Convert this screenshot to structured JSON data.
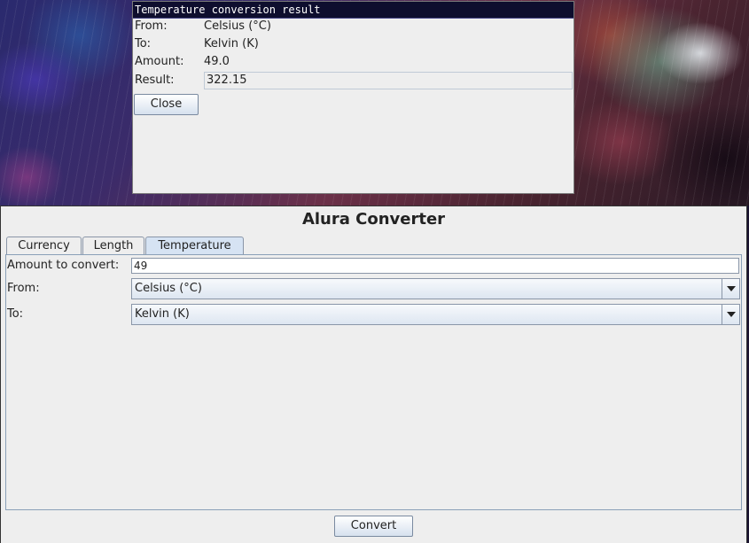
{
  "dialog": {
    "title": "Temperature conversion result",
    "from_label": "From:",
    "from_value": "Celsius (°C)",
    "to_label": "To:",
    "to_value": "Kelvin (K)",
    "amount_label": "Amount:",
    "amount_value": "49.0",
    "result_label": "Result:",
    "result_value": "322.15",
    "close_label": "Close"
  },
  "app": {
    "title": "Alura Converter",
    "tabs": [
      {
        "label": "Currency",
        "active": false
      },
      {
        "label": "Length",
        "active": false
      },
      {
        "label": "Temperature",
        "active": true
      }
    ],
    "form": {
      "amount_label": "Amount to convert:",
      "amount_value": "49",
      "from_label": "From:",
      "from_selected": "Celsius (°C)",
      "to_label": "To:",
      "to_selected": "Kelvin (K)"
    },
    "convert_label": "Convert"
  },
  "icons": {
    "dropdown": "chevron-down-icon"
  }
}
